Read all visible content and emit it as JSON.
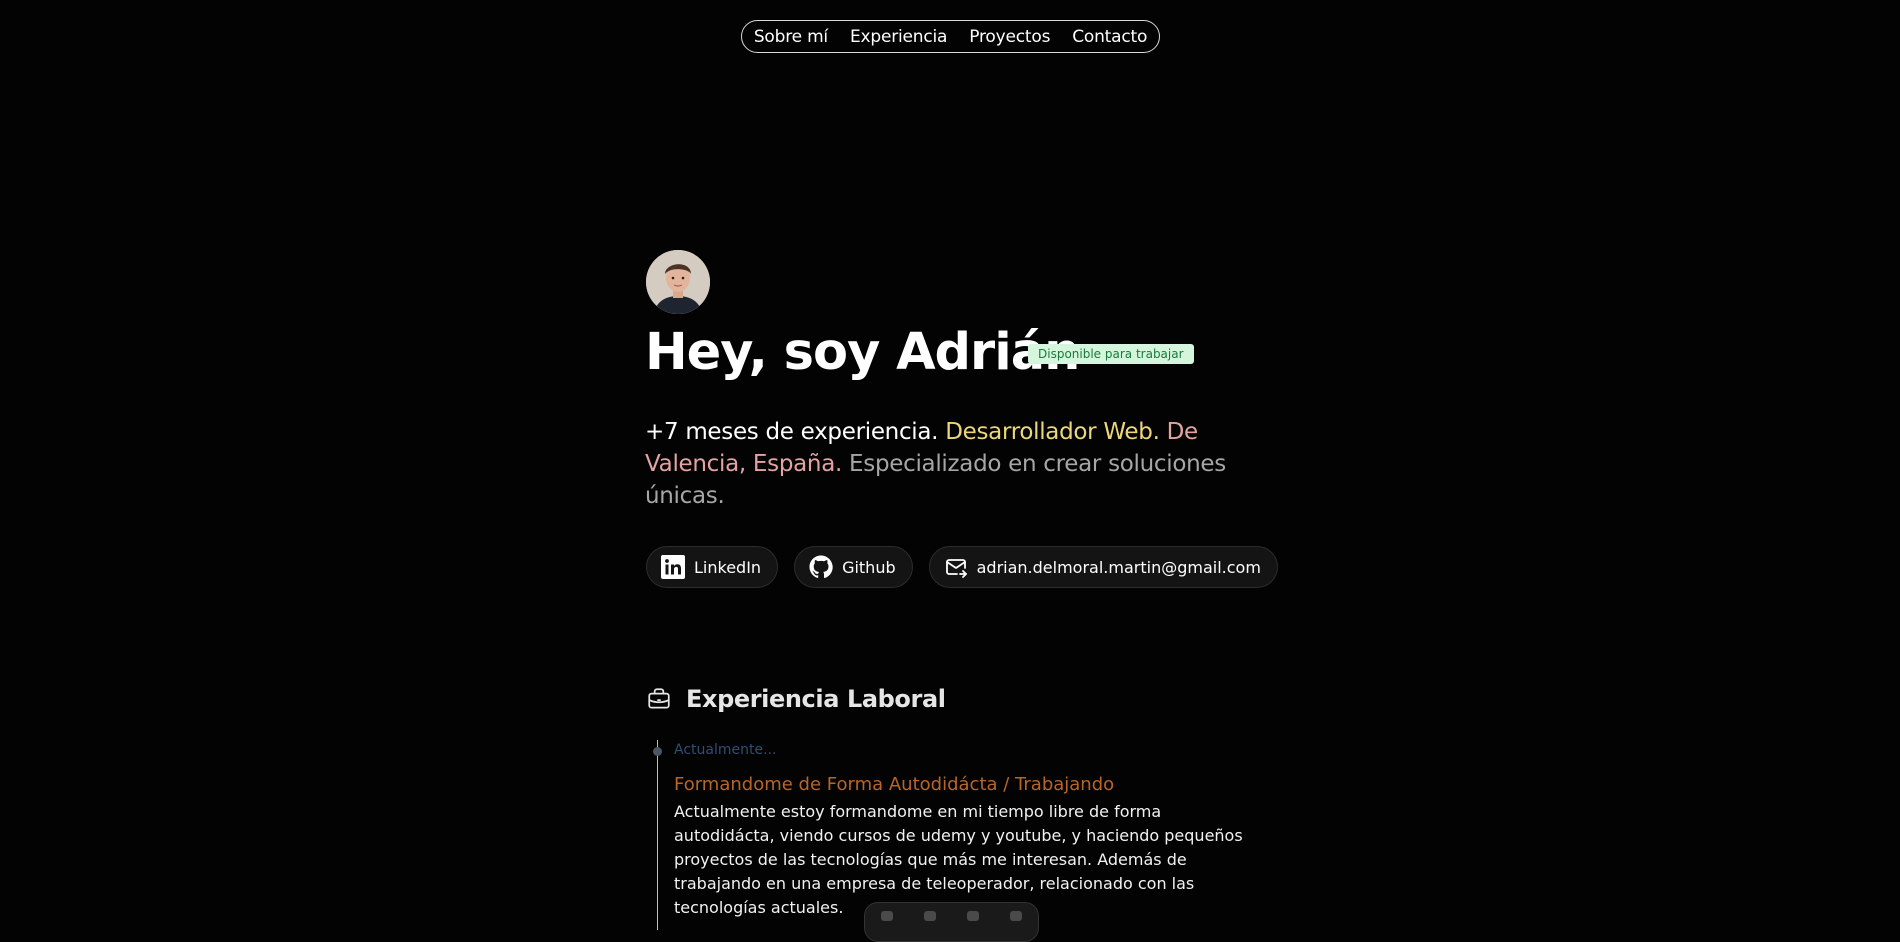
{
  "nav": {
    "items": [
      "Sobre mí",
      "Experiencia",
      "Proyectos",
      "Contacto"
    ]
  },
  "hero": {
    "title": "Hey, soy Adrián",
    "badge": "Disponible para trabajar",
    "intro": {
      "part1": "+7 meses de experiencia.",
      "role": "Desarrollador Web",
      "dot1": ".",
      "location": "De Valencia, España",
      "dot2": ".",
      "part3": "Especializado en crear soluciones únicas."
    },
    "avatar_icon": "user-photo"
  },
  "socials": [
    {
      "label": "LinkedIn",
      "icon": "linkedin-icon"
    },
    {
      "label": "Github",
      "icon": "github-icon"
    },
    {
      "label": "adrian.delmoral.martin@gmail.com",
      "icon": "mail-icon"
    }
  ],
  "experience": {
    "title": "Experiencia Laboral",
    "icon": "briefcase-icon",
    "items": [
      {
        "date": "Actualmente...",
        "role": "Formandome de Forma Autodidácta / Trabajando",
        "description": "Actualmente estoy formandome en mi tiempo libre de forma autodidácta, viendo cursos de udemy y youtube, y haciendo pequeños proyectos de las tecnologías que más me interesan. Además de trabajando en una empresa de teleoperador, relacionado con las tecnologías actuales."
      }
    ]
  },
  "colors": {
    "background": "#030303",
    "role_highlight": "#ecd77a",
    "location_highlight": "#e3a3a3",
    "badge_bg": "#d6f5dd",
    "badge_text": "#1a7a3a",
    "timeline_role": "#b8652a",
    "timeline_date": "#2f4e74"
  }
}
